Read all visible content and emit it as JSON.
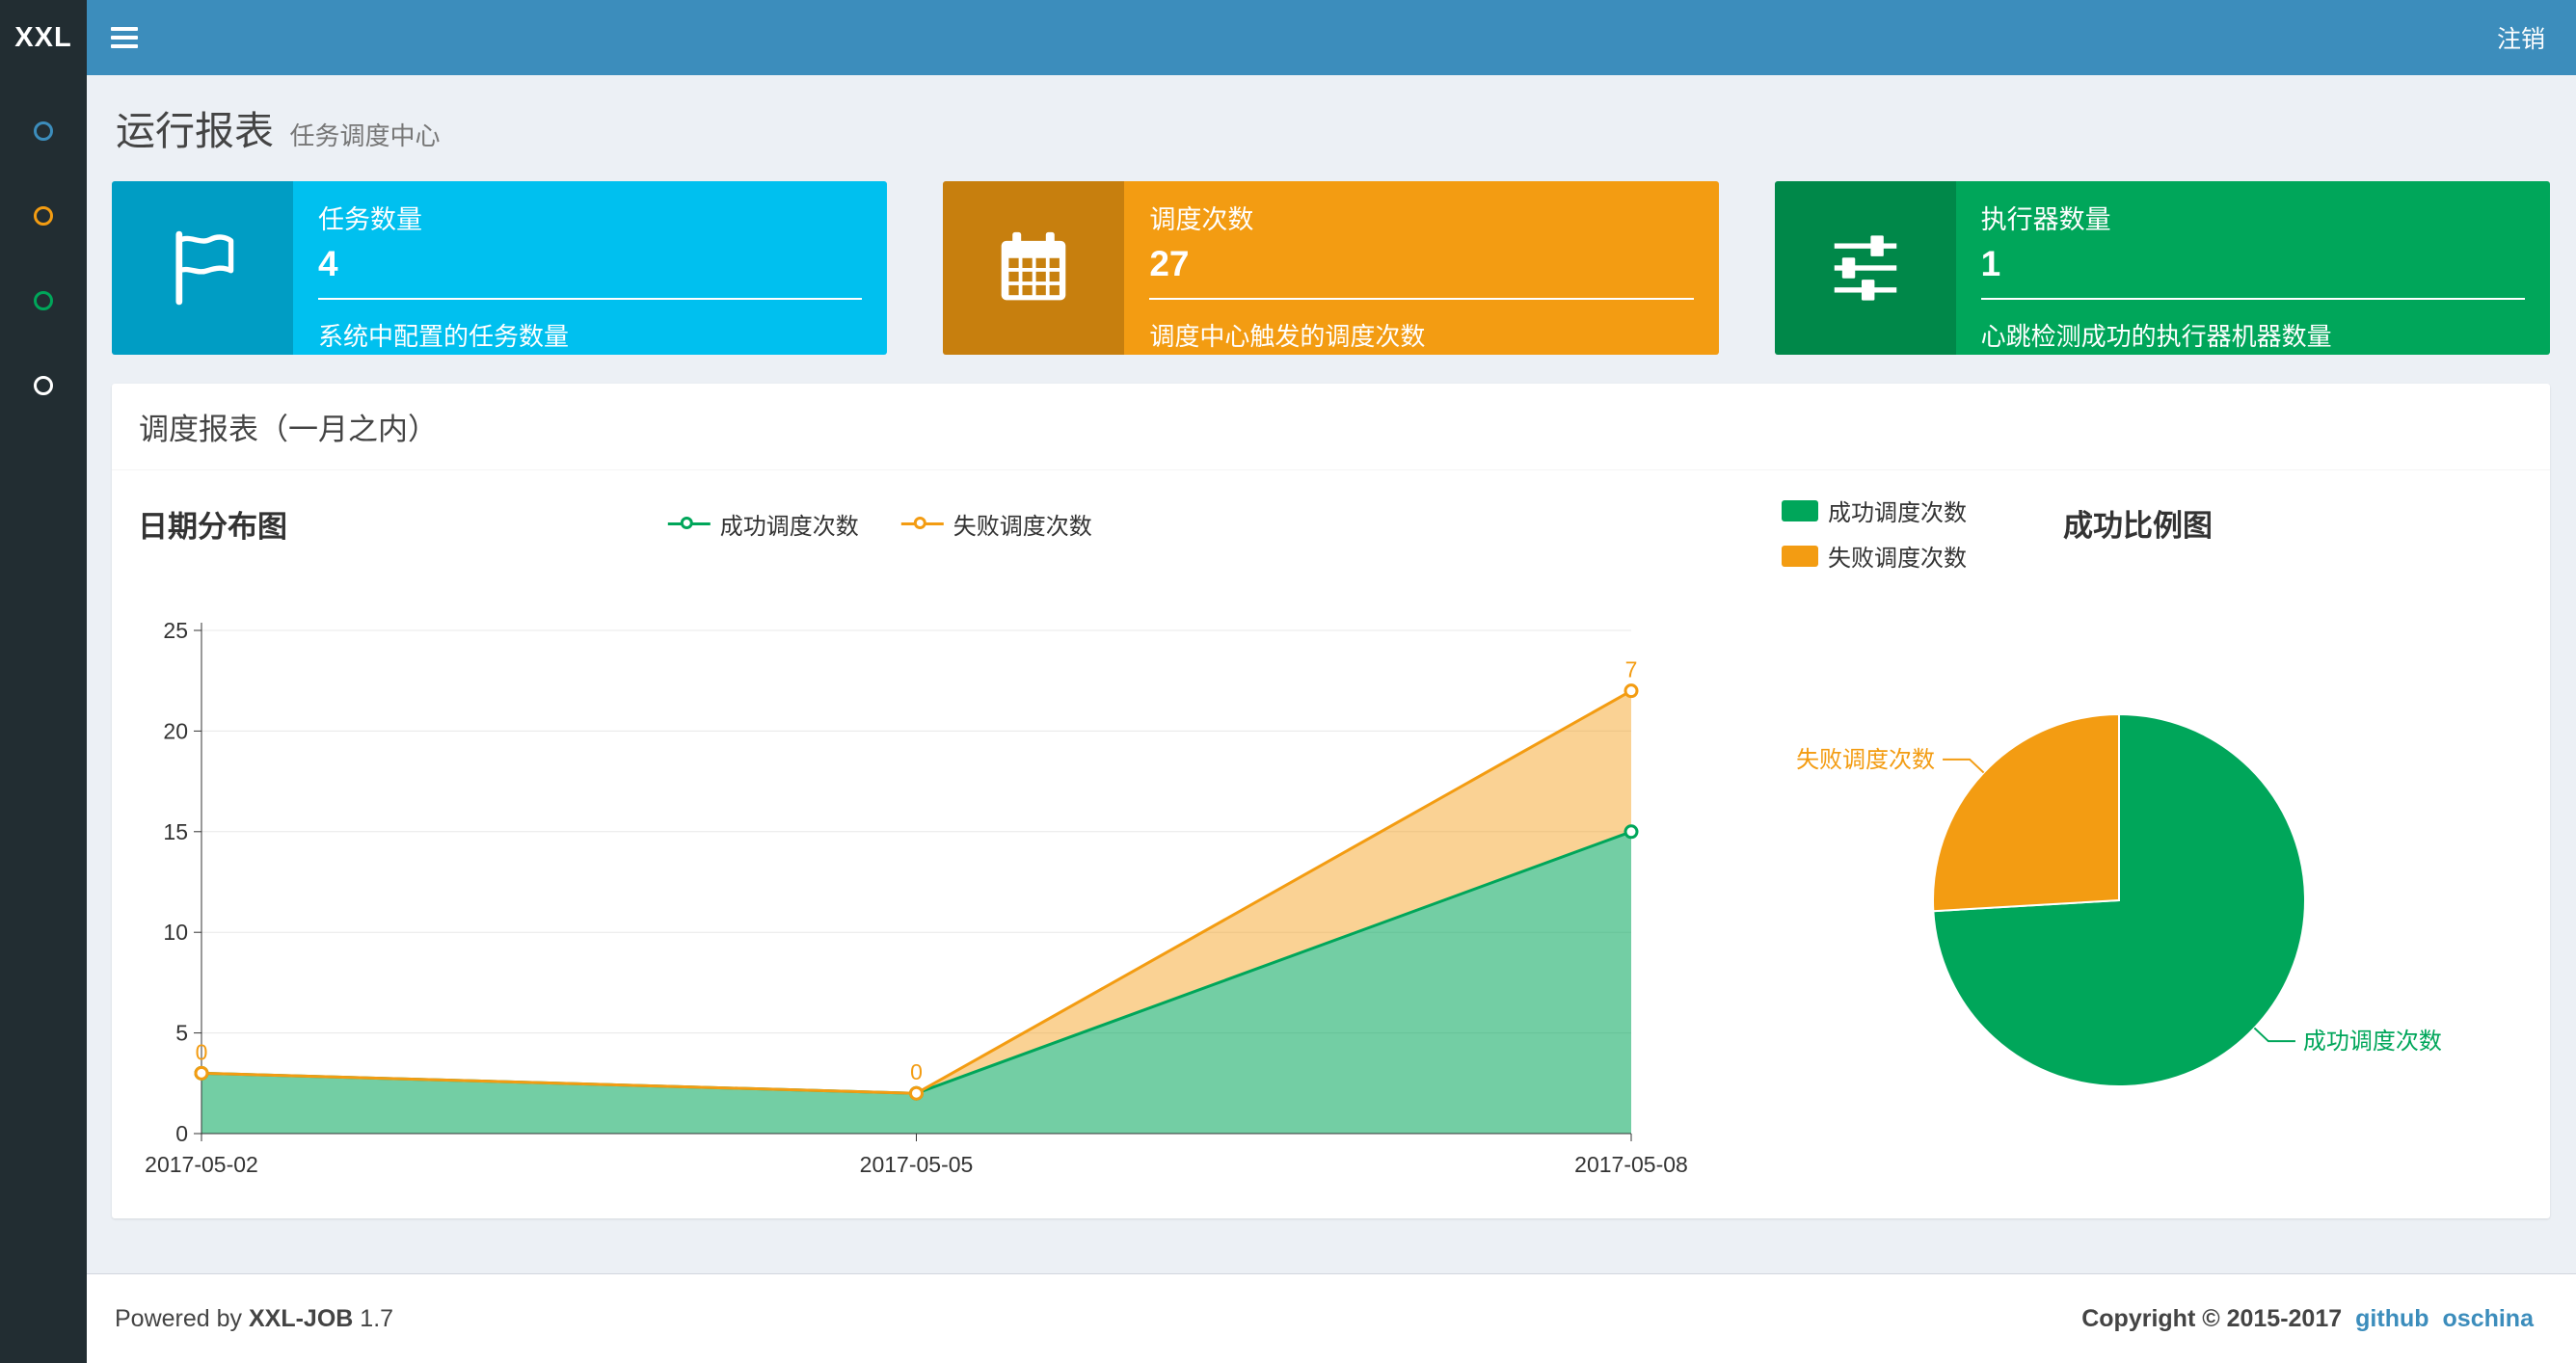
{
  "navbar": {
    "logo": "XXL",
    "logout_label": "注销"
  },
  "sidebar": {
    "items": [
      {
        "name": "menu-item-1",
        "color": "#3c8dbc"
      },
      {
        "name": "menu-item-2",
        "color": "#f39c12"
      },
      {
        "name": "menu-item-3",
        "color": "#00a65a"
      },
      {
        "name": "menu-item-4",
        "color": "#ffffff"
      }
    ]
  },
  "page_header": {
    "title": "运行报表",
    "subtitle": "任务调度中心"
  },
  "info_boxes": [
    {
      "title": "任务数量",
      "value": "4",
      "desc": "系统中配置的任务数量",
      "color": "#00c0ef",
      "icon": "flag-icon"
    },
    {
      "title": "调度次数",
      "value": "27",
      "desc": "调度中心触发的调度次数",
      "color": "#f39c12",
      "icon": "calendar-icon"
    },
    {
      "title": "执行器数量",
      "value": "1",
      "desc": "心跳检测成功的执行器机器数量",
      "color": "#00a65a",
      "icon": "sliders-icon"
    }
  ],
  "panel": {
    "title": "调度报表（一月之内）"
  },
  "chart_data": [
    {
      "type": "area",
      "title": "日期分布图",
      "x": [
        "2017-05-02",
        "2017-05-05",
        "2017-05-08"
      ],
      "series": [
        {
          "name": "成功调度次数",
          "values": [
            3,
            2,
            15
          ],
          "color": "#00a65a"
        },
        {
          "name": "失败调度次数",
          "values": [
            0,
            0,
            7
          ],
          "color": "#f39c12"
        }
      ],
      "stacked": true,
      "point_labels": [
        "0",
        "0",
        "7"
      ],
      "ylim": [
        0,
        25
      ],
      "yticks": [
        0,
        5,
        10,
        15,
        20,
        25
      ],
      "grid": true,
      "legend_position": "top-center"
    },
    {
      "type": "pie",
      "title": "成功比例图",
      "labels": [
        "成功调度次数",
        "失败调度次数"
      ],
      "values": [
        20,
        7
      ],
      "colors": [
        "#00a65a",
        "#f39c12"
      ],
      "legend_position": "top-left"
    }
  ],
  "footer": {
    "powered_prefix": "Powered by",
    "product": "XXL-JOB",
    "version": "1.7",
    "copyright": "Copyright © 2015-2017",
    "links": [
      "github",
      "oschina"
    ]
  }
}
